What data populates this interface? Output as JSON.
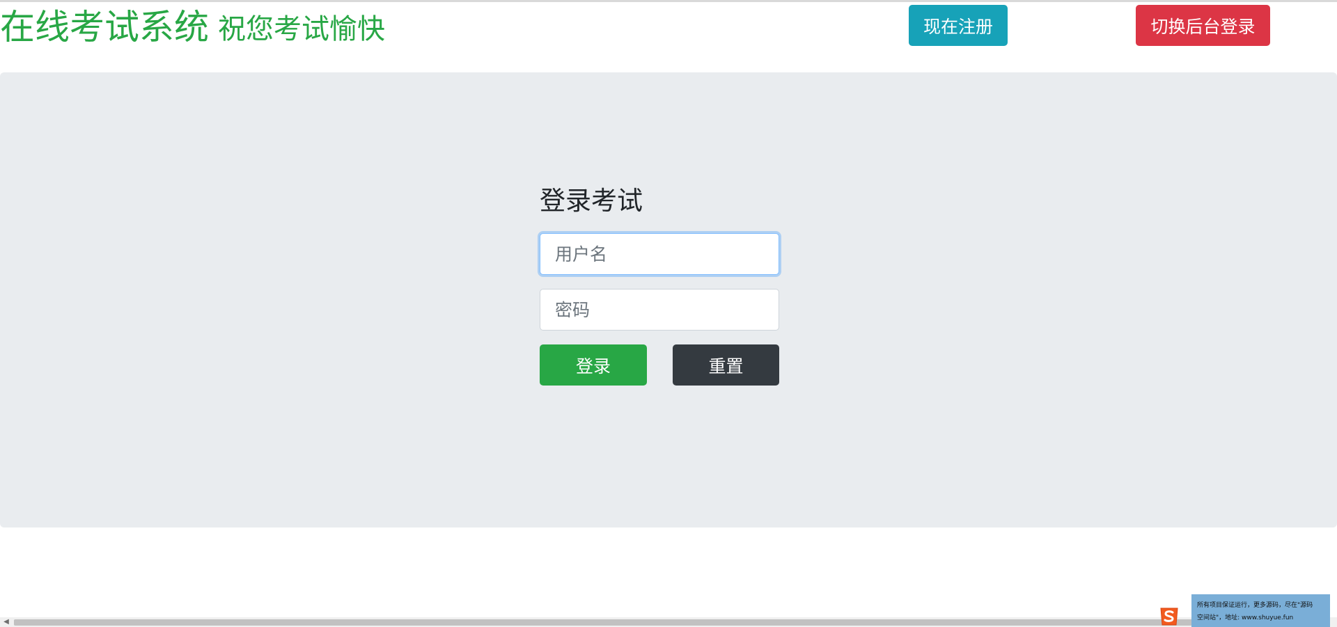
{
  "header": {
    "title": "在线考试系统",
    "subtitle": "祝您考试愉快",
    "register_label": "现在注册",
    "admin_login_label": "切换后台登录"
  },
  "login": {
    "heading": "登录考试",
    "username_placeholder": "用户名",
    "password_placeholder": "密码",
    "login_label": "登录",
    "reset_label": "重置"
  },
  "notice": {
    "line1": "所有项目保证运行，更多源码，尽在\"源码",
    "line2": "空间站\"，地址: www.shuyue.fun"
  },
  "icons": {
    "sogou": "sogou-s-icon",
    "scroll_left": "scroll-left-arrow-icon"
  },
  "colors": {
    "accent_green": "#28a745",
    "info_teal": "#17a2b8",
    "danger_red": "#dc3545",
    "dark": "#343a40",
    "panel_bg": "#e9ecef"
  }
}
